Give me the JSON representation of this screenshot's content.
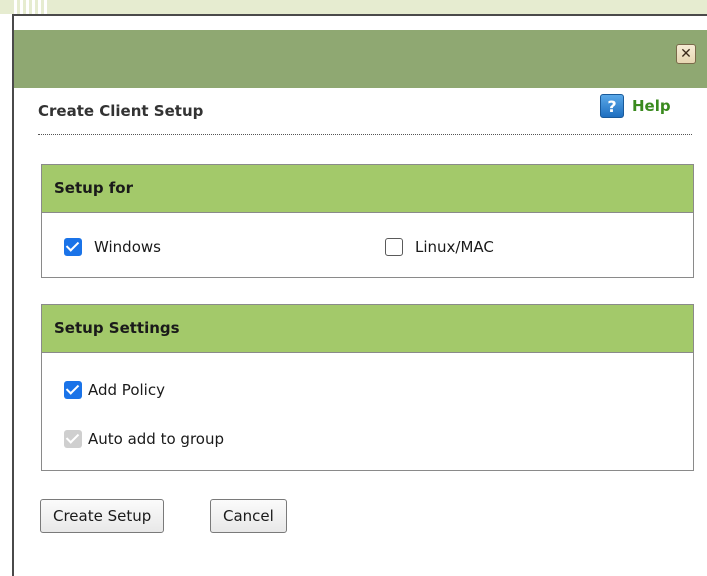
{
  "dialog": {
    "title": "Create Client Setup",
    "help_label": "Help",
    "close_glyph": "✕"
  },
  "setup_for": {
    "header": "Setup for",
    "options": [
      {
        "label": "Windows",
        "checked": true
      },
      {
        "label": "Linux/MAC",
        "checked": false
      }
    ]
  },
  "setup_settings": {
    "header": "Setup Settings",
    "options": [
      {
        "label": "Add Policy",
        "checked": true,
        "disabled": false
      },
      {
        "label": "Auto add to group",
        "checked": true,
        "disabled": true
      }
    ]
  },
  "buttons": {
    "create": "Create Setup",
    "cancel": "Cancel"
  },
  "colors": {
    "titlebar": "#8fa872",
    "panel_header": "#a3c96a",
    "help_text": "#3a8a1e",
    "checkbox_checked": "#1a73e8"
  },
  "icons": {
    "close": "close-icon",
    "help": "help-icon",
    "checkbox": "checkbox-icon"
  }
}
